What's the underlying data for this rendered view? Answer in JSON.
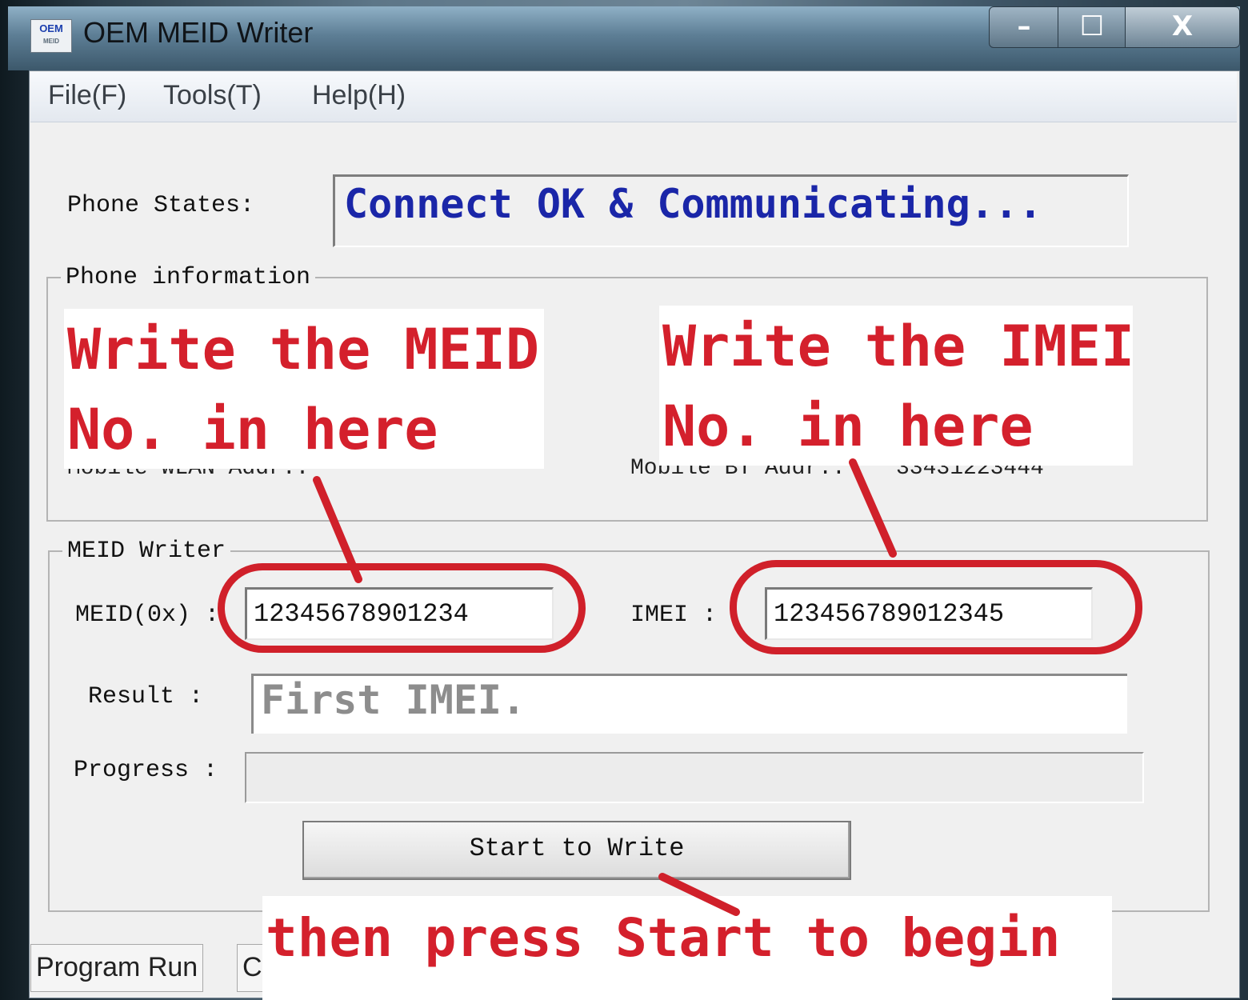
{
  "window": {
    "title": "OEM MEID Writer",
    "icon_text": "OEM",
    "icon_subtext": "MEID",
    "controls": {
      "minimize": "–",
      "maximize": "☐",
      "close": "X"
    }
  },
  "menu": [
    "File(F)",
    "Tools(T)",
    "Help(H)"
  ],
  "phone_states": {
    "label": "Phone States:",
    "value": "Connect OK & Communicating..."
  },
  "phone_information": {
    "title": "Phone information",
    "wlan_label": "Mobile WLAN Addr.:",
    "bt_label": "Mobile BT Addr.:",
    "bt_partial_value": "33431223444"
  },
  "meid_writer": {
    "title": "MEID Writer",
    "meid_label": "MEID(0x) :",
    "meid_value": "12345678901234",
    "imei_label": "IMEI :",
    "imei_value": "123456789012345",
    "result_label": "Result :",
    "result_value": "First IMEI.",
    "progress_label": "Progress :",
    "progress": 0,
    "start_button": "Start to Write"
  },
  "tabs": [
    "Program Run",
    "C"
  ],
  "annotations": {
    "meid_line1": "Write the MEID",
    "meid_line2": "No.  in here",
    "imei_line1": "Write the IMEI",
    "imei_line2": "No.  in here",
    "start_hint": "then press Start to begin",
    "color": "#d0202a"
  }
}
